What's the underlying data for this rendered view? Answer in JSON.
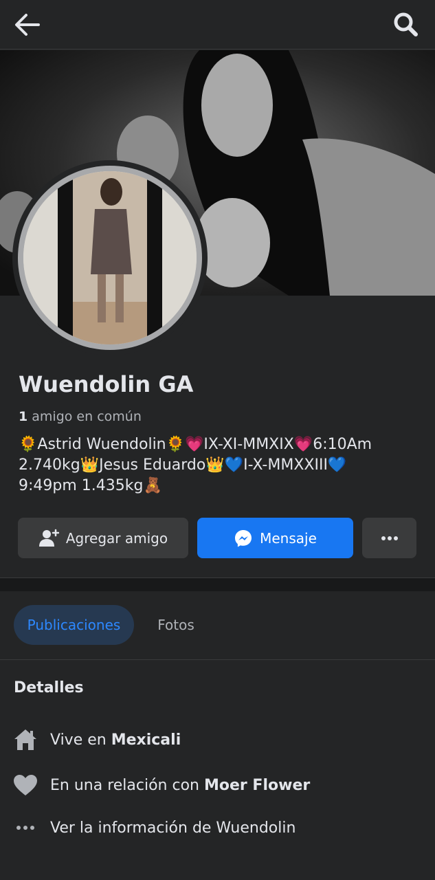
{
  "header": {
    "back_icon": "arrow-left-icon",
    "search_icon": "search-icon"
  },
  "profile": {
    "name": "Wuendolin GA",
    "mutual_count": "1",
    "mutual_text": "amigo en común",
    "bio_lines": [
      "🌻Astrid Wuendolin🌻💗IX-XI-MMXIX💗6:10Am",
      "2.740kg👑Jesus Eduardo👑💙I-X-MMXXIII💙",
      "9:49pm 1.435kg🧸"
    ]
  },
  "actions": {
    "add_friend_label": "Agregar amigo",
    "message_label": "Mensaje",
    "more_icon": "more-horizontal-icon"
  },
  "tabs": [
    {
      "label": "Publicaciones",
      "active": true
    },
    {
      "label": "Fotos",
      "active": false
    }
  ],
  "details": {
    "title": "Detalles",
    "lives_prefix": "Vive en",
    "lives_city": "Mexicali",
    "relationship_prefix": "En una relación con",
    "relationship_name": "Moer Flower",
    "see_info": "Ver la información de Wuendolin"
  },
  "colors": {
    "background": "#242526",
    "accent_blue": "#1877f2",
    "active_tab_text": "#2d88ff",
    "active_tab_bg": "#263951",
    "secondary_button": "#3a3b3c"
  }
}
